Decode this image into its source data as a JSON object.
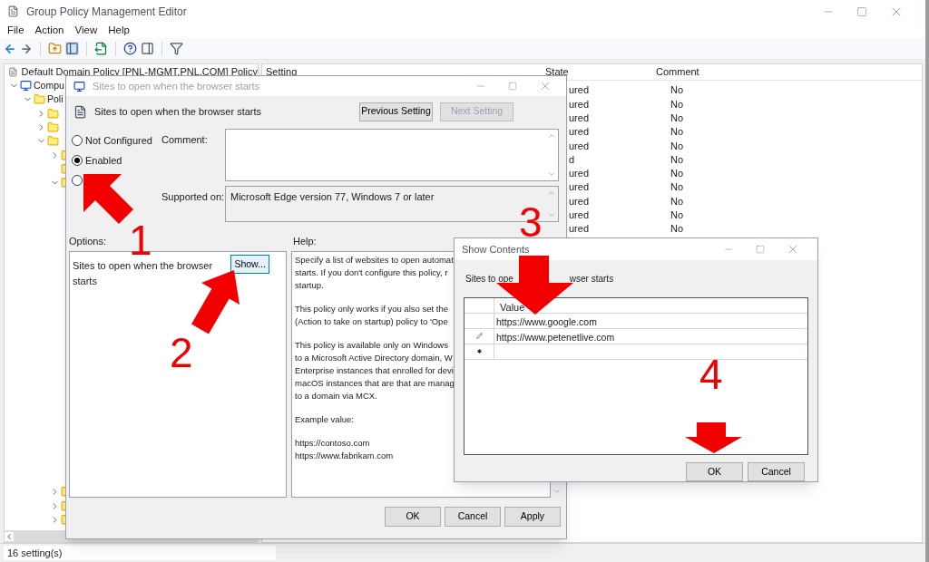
{
  "window": {
    "title": "Group Policy Management Editor"
  },
  "menu": [
    "File",
    "Action",
    "View",
    "Help"
  ],
  "tree": {
    "root": "Default Domain Policy [PNL-MGMT.PNL.COM] Policy",
    "items": [
      {
        "kind": "computer",
        "label": "Compu",
        "expanded": true,
        "children": [
          {
            "kind": "folder",
            "label": "Poli",
            "expanded": true,
            "children": [
              {
                "kind": "folder",
                "expanded": false
              },
              {
                "kind": "folder",
                "expanded": false
              },
              {
                "kind": "folder",
                "expanded": true,
                "children": [
                  {
                    "kind": "folder",
                    "expanded": false
                  },
                  {
                    "kind": "folder"
                  },
                  {
                    "kind": "folder",
                    "expanded": true
                  }
                ]
              }
            ]
          }
        ]
      }
    ],
    "lower_items": [
      {
        "kind": "folder",
        "expanded": false
      },
      {
        "kind": "folder",
        "expanded": false
      },
      {
        "kind": "folder",
        "expanded": false
      }
    ]
  },
  "list": {
    "columns": [
      "Setting",
      "State",
      "Comment"
    ],
    "rows": [
      {
        "state": "ured",
        "comment": "No"
      },
      {
        "state": "ured",
        "comment": "No"
      },
      {
        "state": "ured",
        "comment": "No"
      },
      {
        "state": "ured",
        "comment": "No"
      },
      {
        "state": "ured",
        "comment": "No"
      },
      {
        "state": "d",
        "comment": "No"
      },
      {
        "state": "ured",
        "comment": "No"
      },
      {
        "state": "ured",
        "comment": "No"
      },
      {
        "state": "ured",
        "comment": "No"
      },
      {
        "state": "ured",
        "comment": "No"
      },
      {
        "state": "ured",
        "comment": "No"
      }
    ]
  },
  "policy_dialog": {
    "title": "Sites to open when the browser starts",
    "heading": "Sites to open when the browser starts",
    "nav_buttons": [
      {
        "label": "Previous Setting",
        "disabled": false
      },
      {
        "label": "Next Setting",
        "disabled": true
      }
    ],
    "radios": [
      {
        "label": "Not Configured",
        "selected": false
      },
      {
        "label": "Enabled",
        "selected": true
      },
      {
        "selected": false
      }
    ],
    "comment_label": "Comment:",
    "supported_label": "Supported on:",
    "supported_value": "Microsoft Edge version 77, Windows 7 or later",
    "options_label": "Options:",
    "help_label": "Help:",
    "option_text": "Sites to open when the browser starts",
    "show_button": {
      "label": "Show...",
      "focused": true
    },
    "help": [
      "Specify a list of websites to open automat\nstarts. If you don't configure this policy, r\nstartup.",
      "This policy only works if you also set the\n(Action to take on startup) policy to 'Ope",
      "This policy is available only on Windows\nto a Microsoft Active Directory domain, W\nEnterprise instances that enrolled for devi\nmacOS instances that are that are manag\nto a domain via MCX.",
      "Example value:",
      "https://contoso.com\nhttps://www.fabrikam.com"
    ],
    "buttons": [
      "OK",
      "Cancel",
      "Apply"
    ]
  },
  "show_contents": {
    "title": "Show Contents",
    "label_parts": [
      "Sites to ope",
      "wser starts"
    ],
    "column": "Value",
    "rows": [
      {
        "kind": "entry",
        "value": "https://www.google.com"
      },
      {
        "kind": "editing",
        "value": "https://www.petenetlive.com"
      },
      {
        "kind": "new"
      }
    ],
    "buttons": [
      "OK",
      "Cancel"
    ]
  },
  "annotations": [
    "1",
    "2",
    "3",
    "4"
  ],
  "status_bar": "16 setting(s)"
}
